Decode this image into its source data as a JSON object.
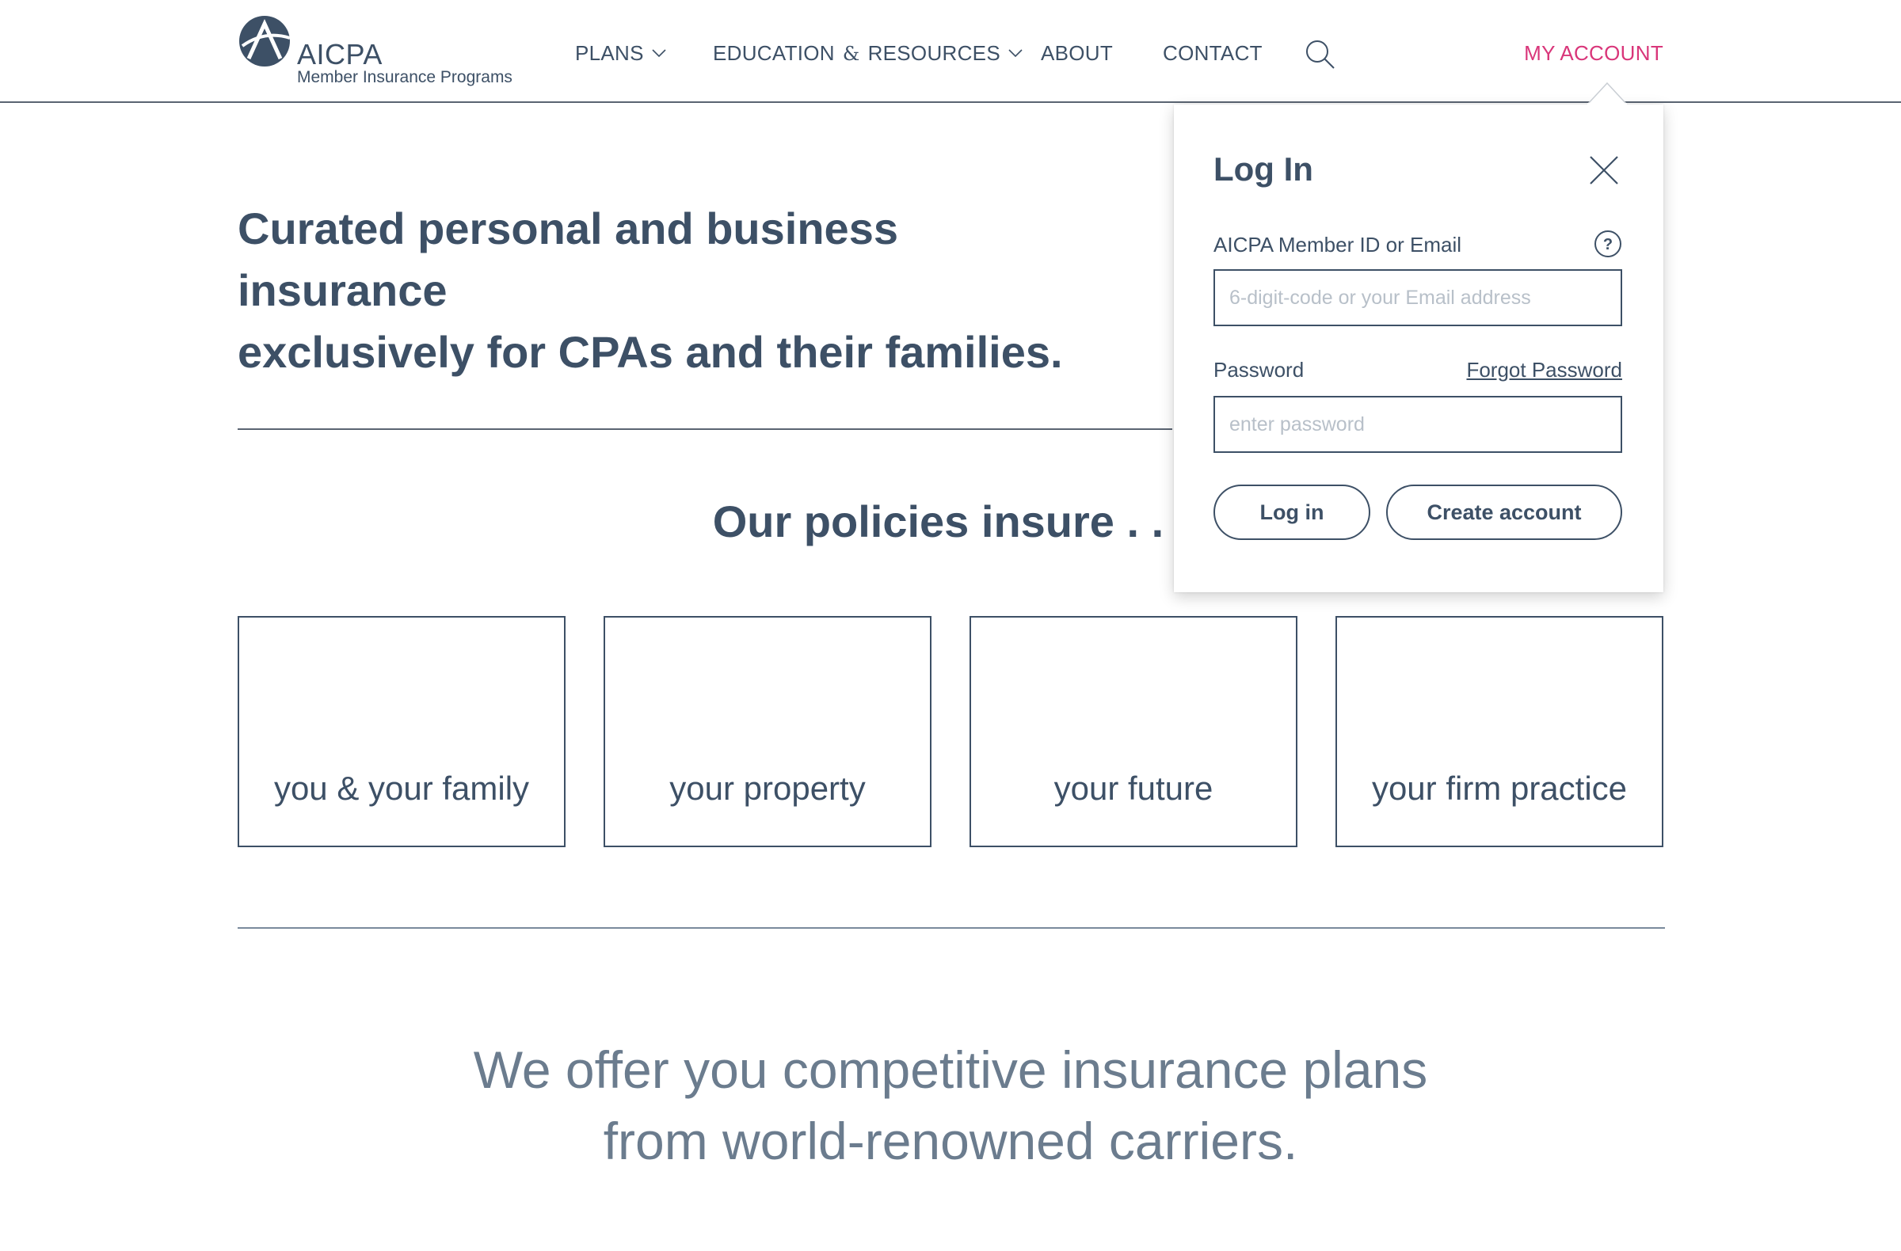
{
  "brand": {
    "name": "AICPA",
    "subtitle": "Member Insurance Programs"
  },
  "nav": {
    "plans": "PLANS",
    "education_1": "EDUCATION",
    "education_amp": "&",
    "education_2": "RESOURCES",
    "about": "ABOUT",
    "contact": "CONTACT",
    "my_account": "MY ACCOUNT"
  },
  "hero": {
    "line1": "Curated personal and business insurance",
    "line2": "exclusively for CPAs and their families."
  },
  "policies": {
    "title": "Our policies insure . . .",
    "cards": [
      {
        "label": "you & your family"
      },
      {
        "label": "your property"
      },
      {
        "label": "your future"
      },
      {
        "label": "your firm practice"
      }
    ]
  },
  "offer": {
    "line1": "We offer you competitive insurance plans",
    "line2": "from world-renowned carriers."
  },
  "login": {
    "title": "Log In",
    "id_label": "AICPA Member ID or Email",
    "id_placeholder": "6-digit-code or your Email address",
    "id_value": "",
    "password_label": "Password",
    "forgot": "Forgot Password",
    "password_placeholder": "enter password",
    "password_value": "",
    "login_button": "Log in",
    "create_button": "Create account"
  },
  "colors": {
    "text": "#3d5066",
    "accent": "#d9367a",
    "muted": "#6b7c8e",
    "placeholder": "#b8c0c9"
  },
  "icons": {
    "logo": "aicpa-logo-icon",
    "dropdown": "chevron-down-icon",
    "search": "search-icon",
    "close": "close-icon",
    "help": "help-icon"
  }
}
